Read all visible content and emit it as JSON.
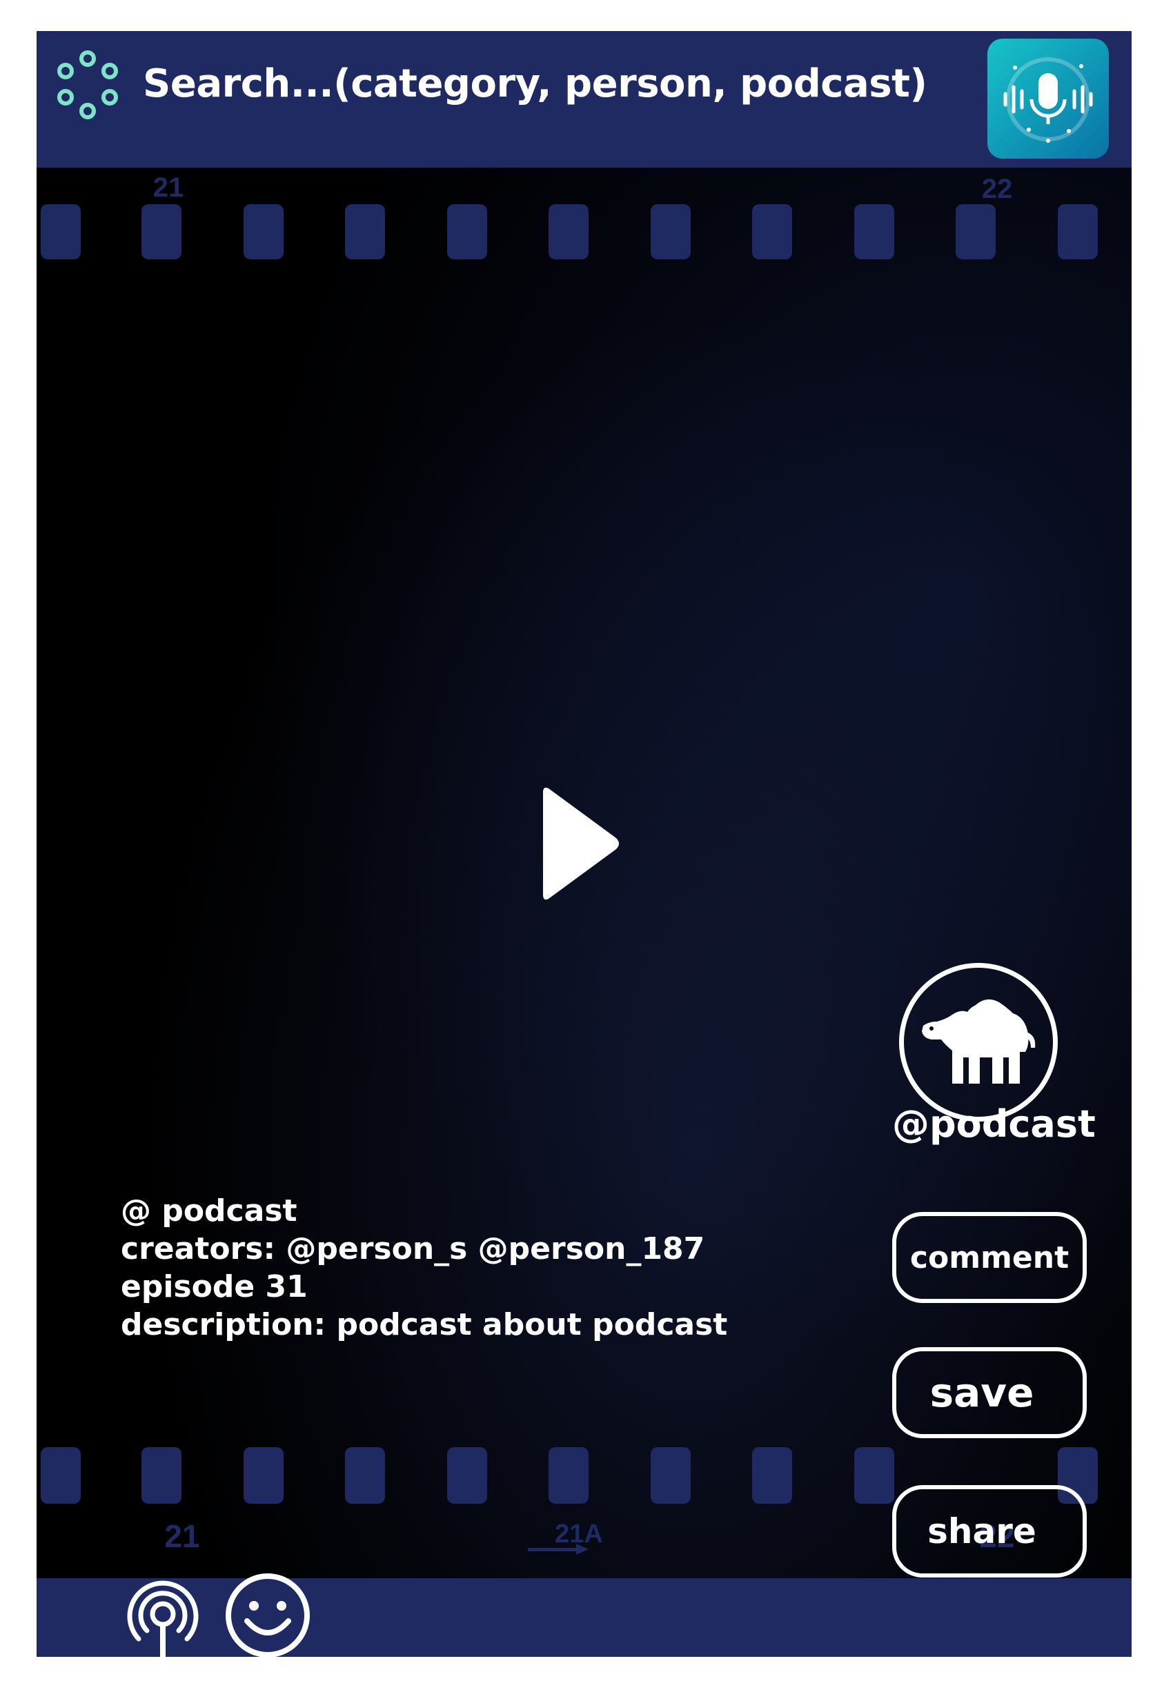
{
  "header": {
    "search_placeholder": "Search...(category, person, podcast)",
    "menu_icon": "dots-circle-icon",
    "mic_icon": "voice-search-mic-icon"
  },
  "film": {
    "top_frame_numbers": [
      "21",
      "22"
    ],
    "bottom_frame_numbers": [
      "21",
      "21A",
      "22"
    ]
  },
  "player": {
    "play_icon": "play-icon"
  },
  "side": {
    "avatar_icon": "camel-icon",
    "handle": "@podcast",
    "comment_label": "comment",
    "save_label": "save",
    "share_label": "share"
  },
  "info": {
    "podcast": "@ podcast",
    "creators": "creators: @person_s @person_187",
    "episode": "episode 31",
    "description": "description: podcast about podcast"
  },
  "footer": {
    "items": [
      {
        "icon": "podcast-broadcast-icon"
      },
      {
        "icon": "smiley-face-icon"
      }
    ]
  },
  "colors": {
    "navy": "#1f2a63",
    "background": "#000000",
    "text": "#ffffff",
    "accent_teal": "#7fe3c8",
    "mic_gradient": [
      "#17c3c9",
      "#0a73a6"
    ]
  }
}
